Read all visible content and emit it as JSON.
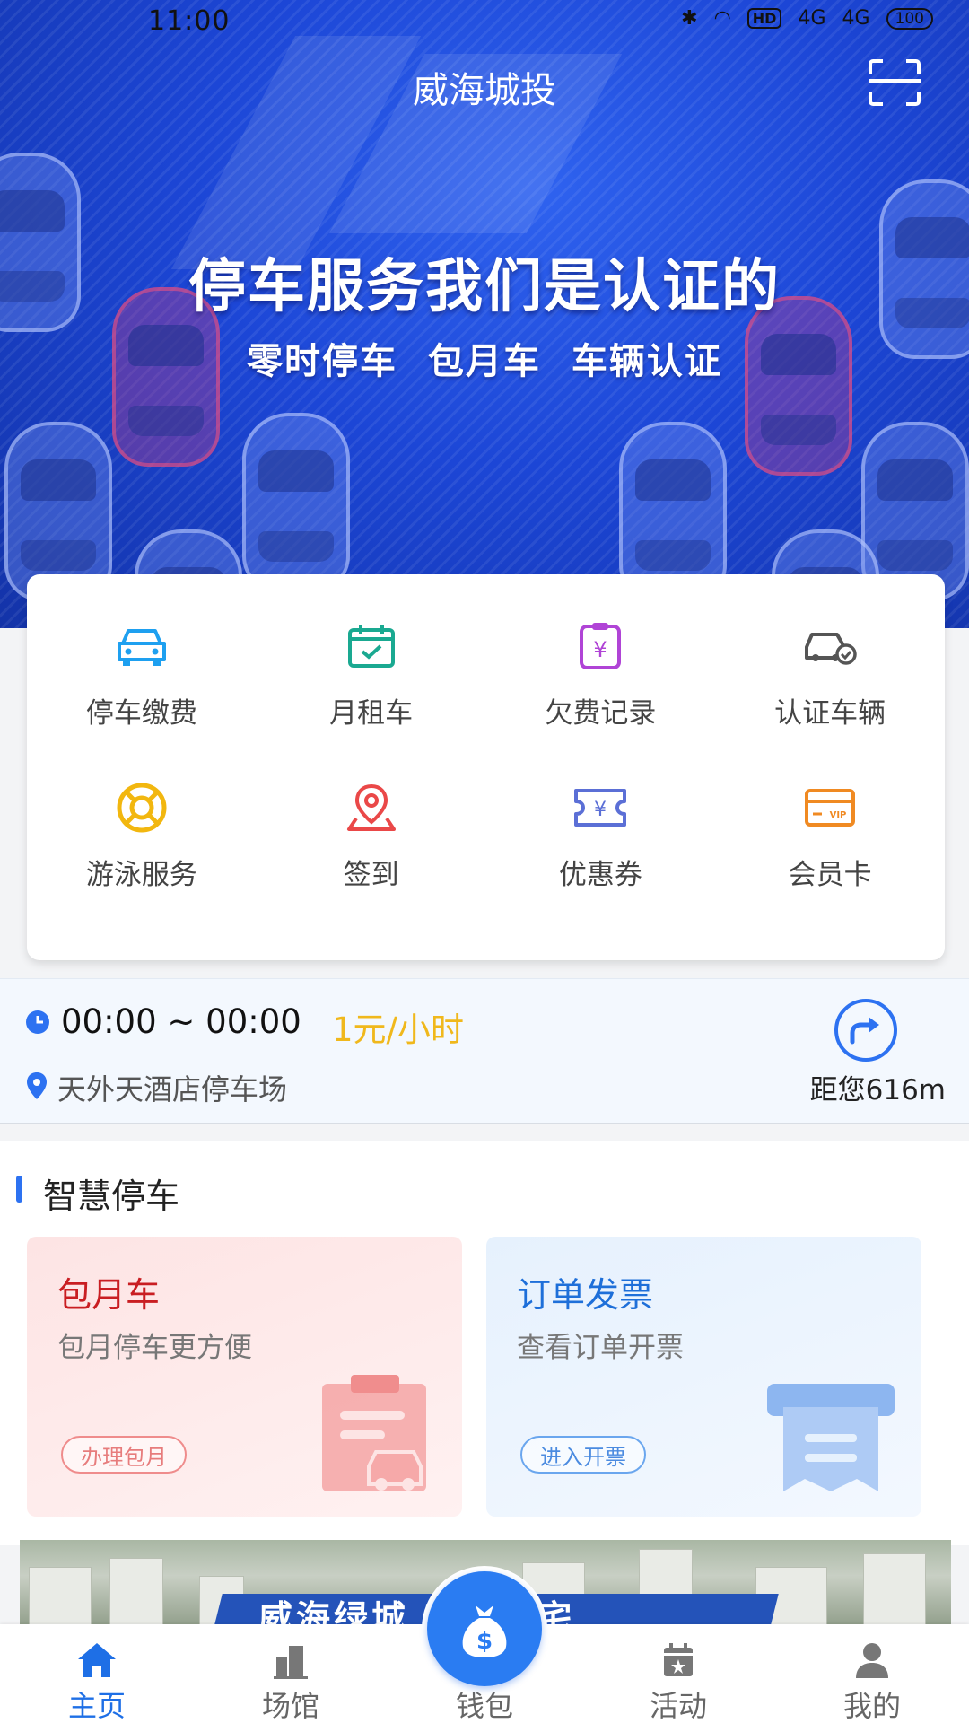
{
  "status_bar": {
    "time": "11:00",
    "hd": "HD",
    "net1": "4G",
    "net2": "4G",
    "battery": "100"
  },
  "header": {
    "title": "威海城投",
    "scan_icon": "scan-icon"
  },
  "banner": {
    "headline": "停车服务我们是认证的",
    "subline": "零时停车 包月车 车辆认证"
  },
  "services": [
    {
      "label": "停车缴费",
      "icon": "car-icon",
      "color": "#1ea0f0"
    },
    {
      "label": "月租车",
      "icon": "calendar-check-icon",
      "color": "#1aa991"
    },
    {
      "label": "欠费记录",
      "icon": "yen-clipboard-icon",
      "color": "#b044d6"
    },
    {
      "label": "认证车辆",
      "icon": "car-verified-icon",
      "color": "#555555"
    },
    {
      "label": "游泳服务",
      "icon": "lifebuoy-icon",
      "color": "#f2b70f"
    },
    {
      "label": "签到",
      "icon": "location-pin-icon",
      "color": "#ea4848"
    },
    {
      "label": "优惠券",
      "icon": "coupon-icon",
      "color": "#5b6fd6"
    },
    {
      "label": "会员卡",
      "icon": "vip-card-icon",
      "color": "#f08a22"
    }
  ],
  "parking": {
    "time_range": "00:00 ~ 00:00",
    "price": "1元/小时",
    "lot_name": "天外天酒店停车场",
    "distance": "距您616m"
  },
  "smart_parking": {
    "title": "智慧停车",
    "cards": [
      {
        "title": "包月车",
        "desc": "包月停车更方便",
        "button": "办理包月"
      },
      {
        "title": "订单发票",
        "desc": "查看订单开票",
        "button": "进入开票"
      }
    ]
  },
  "promo": {
    "text": "威海绿城 新缺住宅"
  },
  "tabbar": {
    "tabs": [
      {
        "label": "主页",
        "icon": "home-icon",
        "active": true
      },
      {
        "label": "场馆",
        "icon": "buildings-icon",
        "active": false
      },
      {
        "label": "钱包",
        "icon": "money-bag-icon",
        "active": false
      },
      {
        "label": "活动",
        "icon": "calendar-star-icon",
        "active": false
      },
      {
        "label": "我的",
        "icon": "user-icon",
        "active": false
      }
    ]
  },
  "colors": {
    "primary": "#2a7cf2",
    "price": "#f0b81c",
    "card_red": "#c91e22",
    "card_blue": "#1e6fd9"
  }
}
